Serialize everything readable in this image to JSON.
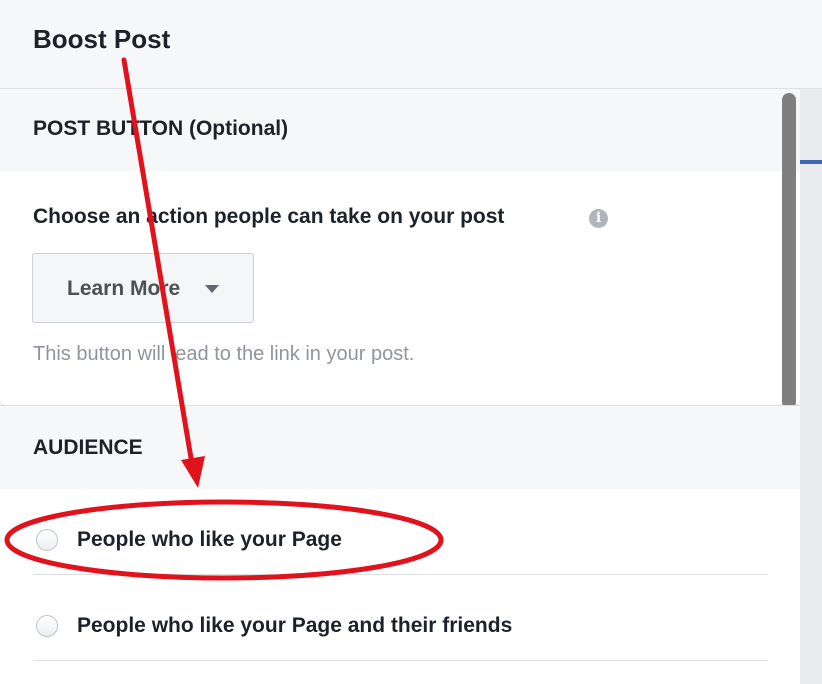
{
  "header": {
    "title": "Boost Post"
  },
  "post_button_section": {
    "title": "POST BUTTON (Optional)",
    "choose_label": "Choose an action people can take on your post",
    "info_icon": "info-icon",
    "dropdown_value": "Learn More",
    "helper_text": "This button will lead to the link in your post."
  },
  "audience_section": {
    "title": "AUDIENCE",
    "options": [
      {
        "label": "People who like your Page"
      },
      {
        "label": "People who like your Page and their friends"
      }
    ]
  },
  "annotation": {
    "color": "#e0131c",
    "arrow": "red-arrow",
    "highlight": "red-ellipse"
  }
}
